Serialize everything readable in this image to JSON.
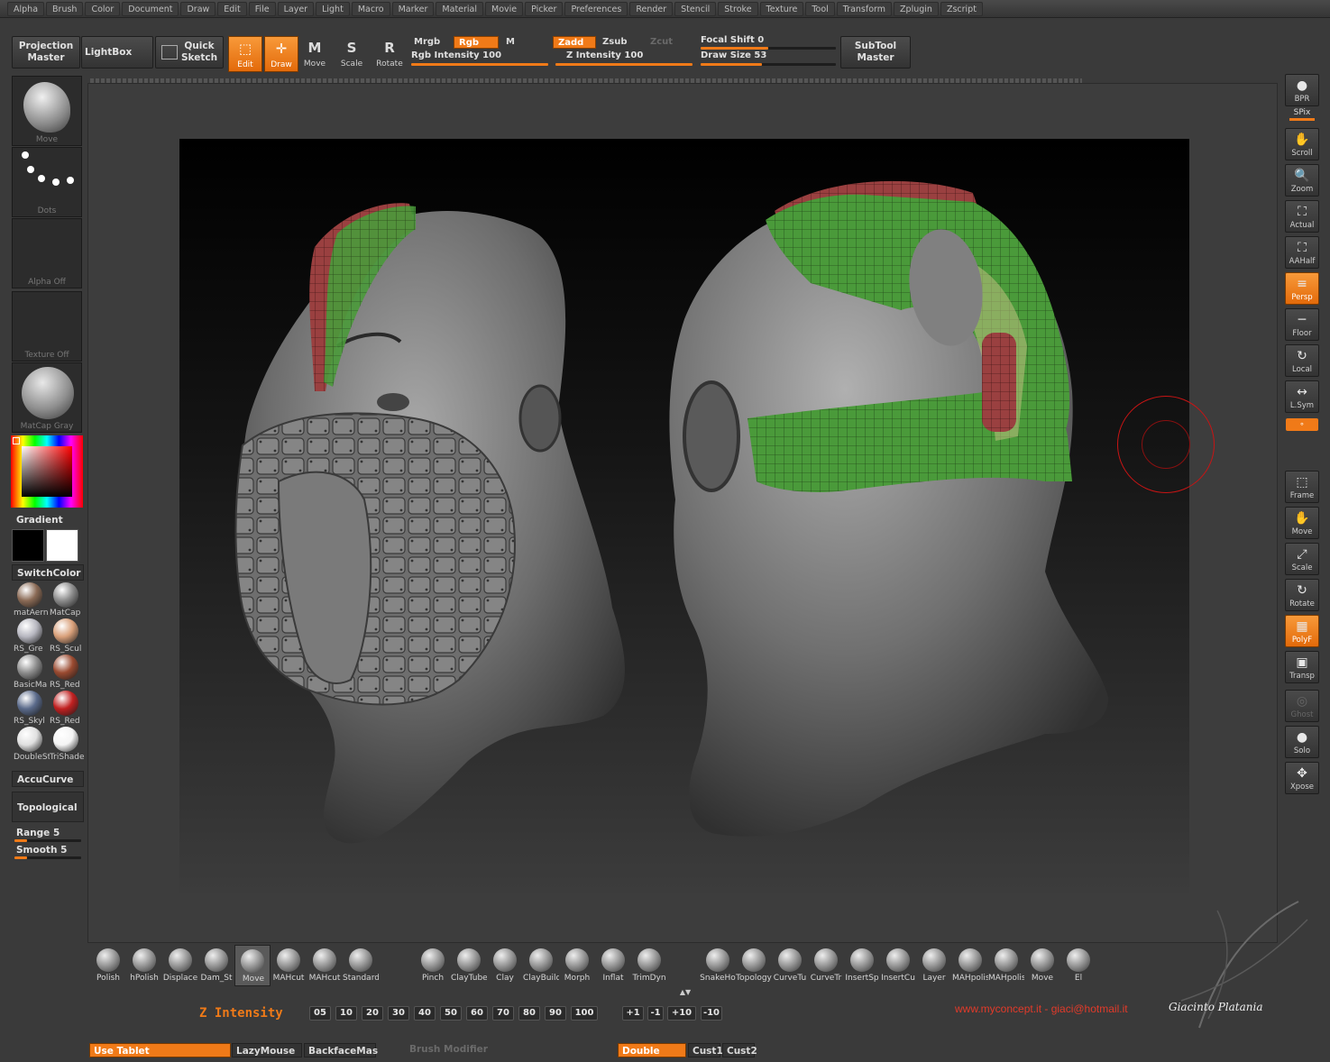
{
  "menu": [
    "Alpha",
    "Brush",
    "Color",
    "Document",
    "Draw",
    "Edit",
    "File",
    "Layer",
    "Light",
    "Macro",
    "Marker",
    "Material",
    "Movie",
    "Picker",
    "Preferences",
    "Render",
    "Stencil",
    "Stroke",
    "Texture",
    "Tool",
    "Transform",
    "Zplugin",
    "Zscript"
  ],
  "toolbar": {
    "projection_master": [
      "Projection",
      "Master"
    ],
    "lightbox": "LightBox",
    "quick_sketch": [
      "Quick",
      "Sketch"
    ],
    "edit": "Edit",
    "draw": "Draw",
    "move": "Move",
    "scale": "Scale",
    "rotate": "Rotate",
    "mrgb": "Mrgb",
    "rgb": "Rgb",
    "m": "M",
    "rgb_intensity": "Rgb  Intensity 100",
    "zadd": "Zadd",
    "zsub": "Zsub",
    "zcut": "Zcut",
    "z_intensity": "Z  Intensity 100",
    "focal_shift": "Focal  Shift 0",
    "draw_size": "Draw  Size 53",
    "subtool_master": [
      "SubTool",
      "Master"
    ],
    "rgb_intensity_value": 100,
    "z_intensity_value": 100,
    "focal_shift_value": 0,
    "draw_size_value": 53
  },
  "left": {
    "brush_label": "Move",
    "stroke_label": "Dots",
    "alpha_label": "Alpha  Off",
    "texture_label": "Texture  Off",
    "material_label": "MatCap  Gray",
    "gradient": "Gradient",
    "switchcolor": "SwitchColor",
    "materials": [
      {
        "name": "matAern",
        "color": "#8a6a55"
      },
      {
        "name": "MatCap",
        "color": "#8c8c8c"
      },
      {
        "name": "RS_Gre",
        "color": "#b7b7c0"
      },
      {
        "name": "RS_Scul",
        "color": "#d9a07a"
      },
      {
        "name": "BasicMa",
        "color": "#8d8d8d"
      },
      {
        "name": "RS_Red",
        "color": "#9a4a30"
      },
      {
        "name": "RS_Skyl",
        "color": "#5a6a8a"
      },
      {
        "name": "RS_Red",
        "color": "#c02020"
      },
      {
        "name": "DoubleSt",
        "color": "#e0e0e0"
      },
      {
        "name": "TriShade",
        "color": "#f4f4f4"
      }
    ],
    "accucurve": "AccuCurve",
    "topological": "Topological",
    "range": "Range 5",
    "smooth": "Smooth 5"
  },
  "right": [
    "BPR",
    "SPix",
    "Scroll",
    "Zoom",
    "Actual",
    "AAHalf",
    "Persp",
    "Floor",
    "Local",
    "L.Sym",
    "Frame",
    "Move",
    "Scale",
    "Rotate",
    "PolyF",
    "Transp",
    "Ghost",
    "Solo",
    "Xpose"
  ],
  "brushes_a": [
    "Polish",
    "hPolish",
    "Displace",
    "Dam_St",
    "Move",
    "MAHcut",
    "MAHcut",
    "Standard"
  ],
  "brushes_b": [
    "Pinch",
    "ClayTube",
    "Clay",
    "ClayBuild",
    "Morph",
    "Inflat",
    "TrimDyn"
  ],
  "brushes_c": [
    "SnakeHo",
    "Topology",
    "CurveTu",
    "CurveTr",
    "InsertSp",
    "InsertCu",
    "Layer",
    "MAHpolis",
    "MAHpolis",
    "Move",
    "El"
  ],
  "bottom": {
    "z_intensity": "Z Intensity",
    "numbers": [
      "05",
      "10",
      "20",
      "30",
      "40",
      "50",
      "60",
      "70",
      "80",
      "90",
      "100"
    ],
    "steps": [
      "+1",
      "-1",
      "+10",
      "-10"
    ],
    "credits": "www.myconcept.it - giaci@hotmail.it",
    "signature": "Giacinto Platania",
    "use_tablet": "Use Tablet",
    "lazymouse": "LazyMouse",
    "backface": "BackfaceMas",
    "brush_modifier": "Brush  Modifier",
    "double": "Double",
    "cust1": "Cust1",
    "cust2": "Cust2"
  },
  "colors": {
    "accent": "#f07a18",
    "primary_color": "#000000",
    "secondary_color": "#ffffff"
  }
}
